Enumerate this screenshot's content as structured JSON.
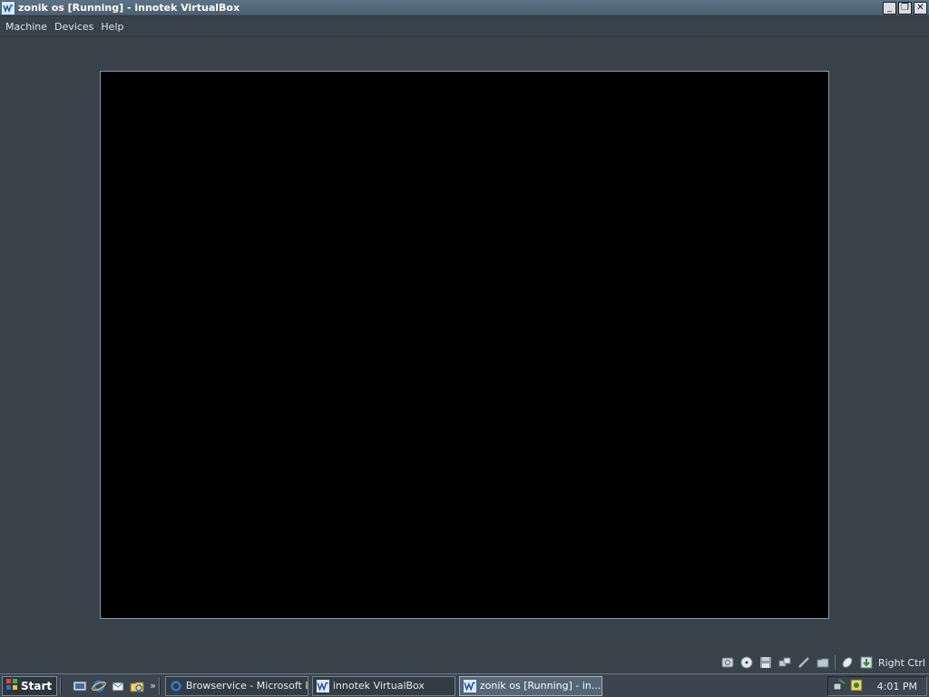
{
  "window": {
    "title": "zonik os [Running] - innotek VirtualBox",
    "icon": "virtualbox-icon",
    "controls": {
      "minimize": "_",
      "restore": "❐",
      "close": "✕"
    }
  },
  "menubar": {
    "items": [
      "Machine",
      "Devices",
      "Help"
    ]
  },
  "vm_screen": {
    "color": "#000000"
  },
  "status_strip": {
    "icons": [
      "hard-disk-icon",
      "cd-dvd-icon",
      "floppy-icon",
      "network-icon",
      "usb-icon",
      "shared-folders-icon",
      "mouse-integration-icon",
      "host-key-icon"
    ],
    "host_key_label": "Right Ctrl"
  },
  "taskbar": {
    "start_label": "Start",
    "quick_launch": [
      "show-desktop-icon",
      "internet-explorer-icon",
      "outlook-express-icon",
      "windows-explorer-icon"
    ],
    "overflow": "»",
    "tasks": [
      {
        "label": "Browservice - Microsoft I...",
        "icon": "internet-explorer-icon",
        "active": false
      },
      {
        "label": "innotek VirtualBox",
        "icon": "virtualbox-icon",
        "active": false
      },
      {
        "label": "zonik os [Running] - in...",
        "icon": "virtualbox-icon",
        "active": true
      }
    ],
    "tray_icons": [
      "network-tray-icon",
      "security-tray-icon"
    ],
    "clock": "4:01 PM"
  },
  "colors": {
    "desktop_bg": "#37424a",
    "titlebar": "#4a5e6e",
    "taskbar": "#3a4550",
    "vm_screen": "#000000"
  }
}
